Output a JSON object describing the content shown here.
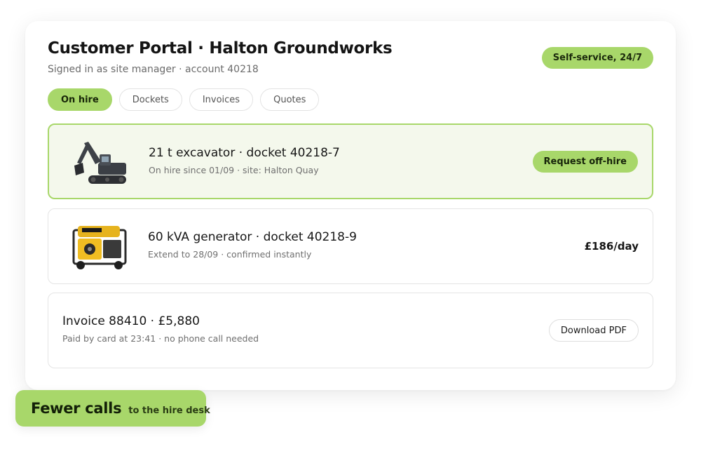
{
  "header": {
    "title": "Customer Portal · Halton Groundworks",
    "subtitle": "Signed in as site manager · account 40218",
    "badge": "Self-service, 24/7"
  },
  "tabs": [
    {
      "label": "On hire",
      "active": true
    },
    {
      "label": "Dockets",
      "active": false
    },
    {
      "label": "Invoices",
      "active": false
    },
    {
      "label": "Quotes",
      "active": false
    }
  ],
  "items": [
    {
      "title": "21 t excavator · docket 40218-7",
      "subtitle": "On hire since 01/09 · site: Halton Quay",
      "action": "Request off-hire",
      "image": "excavator-icon"
    },
    {
      "title": "60 kVA generator · docket 40218-9",
      "subtitle": "Extend to 28/09 · confirmed instantly",
      "price": "£186/day",
      "image": "generator-icon"
    },
    {
      "title": "Invoice 88410 · £5,880",
      "subtitle": "Paid by card at 23:41 · no phone call needed",
      "action": "Download PDF"
    }
  ],
  "callout": {
    "main": "Fewer calls",
    "sub": "to the hire desk"
  },
  "colors": {
    "accent": "#a8d76a",
    "highlight_bg": "#f4f8ec",
    "text": "#141414",
    "muted": "#6b6b6b"
  }
}
